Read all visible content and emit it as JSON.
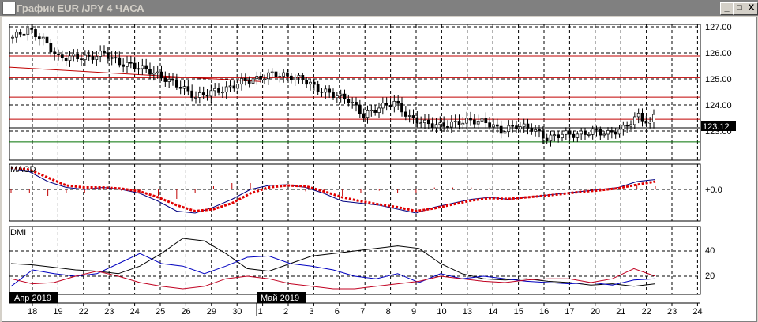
{
  "window": {
    "title": "График EUR /JPY  4 ЧАСА",
    "minimize": "_",
    "maximize": "□",
    "close": "X"
  },
  "price_axis": {
    "ticks": [
      "127.00",
      "126.00",
      "125.00",
      "124.00",
      "123.00"
    ],
    "tick_values": [
      127,
      126,
      125,
      124,
      123
    ],
    "current": "123.12",
    "current_value": 123.12
  },
  "levels": {
    "red": [
      125.88,
      125.05,
      124.3,
      123.45
    ],
    "green": 122.58,
    "trend_start": 125.45,
    "trend_end": 124.9
  },
  "candles_daily": [
    126.6,
    126.9,
    126.5,
    125.8,
    125.85,
    125.8,
    126.0,
    125.6,
    125.5,
    125.3,
    125.0,
    124.7,
    124.3,
    124.5,
    124.6,
    124.9,
    125.0,
    125.2,
    125.1,
    125.0,
    124.6,
    124.4,
    124.2,
    123.6,
    123.9,
    124.1,
    123.5,
    123.3,
    123.2,
    123.3,
    123.4,
    123.35,
    123.0,
    123.2,
    123.1,
    122.7,
    122.9,
    122.85,
    123.0,
    122.9,
    123.1,
    123.6,
    123.12
  ],
  "macd": {
    "label": "MACD",
    "zero_label": "+0.0",
    "line": [
      0.5,
      0.45,
      0.2,
      0.05,
      0,
      0.05,
      0.0,
      -0.1,
      -0.3,
      -0.55,
      -0.6,
      -0.45,
      -0.25,
      0,
      0.1,
      0.12,
      0.05,
      -0.1,
      -0.3,
      -0.35,
      -0.4,
      -0.5,
      -0.6,
      -0.45,
      -0.35,
      -0.25,
      -0.2,
      -0.25,
      -0.2,
      -0.15,
      -0.1,
      -0.05,
      0,
      0.05,
      0.2,
      0.25
    ],
    "signal": [
      0.55,
      0.5,
      0.3,
      0.1,
      0.05,
      0.05,
      0.02,
      -0.05,
      -0.2,
      -0.4,
      -0.55,
      -0.5,
      -0.35,
      -0.1,
      0.05,
      0.1,
      0.08,
      -0.05,
      -0.2,
      -0.3,
      -0.38,
      -0.45,
      -0.55,
      -0.48,
      -0.38,
      -0.28,
      -0.22,
      -0.24,
      -0.2,
      -0.16,
      -0.11,
      -0.06,
      -0.02,
      0.03,
      0.12,
      0.2
    ]
  },
  "dmi": {
    "label": "DMI",
    "ticks": [
      "40",
      "20"
    ],
    "tick_values": [
      40,
      20
    ],
    "adx": [
      30,
      29,
      27,
      25,
      24,
      22,
      28,
      38,
      50,
      48,
      38,
      26,
      24,
      30,
      36,
      38,
      40,
      42,
      44,
      42,
      30,
      22,
      18,
      17,
      18,
      16,
      15,
      13,
      14,
      12,
      14
    ],
    "plus_di": [
      12,
      25,
      22,
      20,
      22,
      30,
      38,
      30,
      28,
      22,
      28,
      35,
      36,
      30,
      28,
      25,
      20,
      18,
      22,
      15,
      22,
      18,
      20,
      18,
      16,
      15,
      14,
      15,
      13,
      17,
      18
    ],
    "minus_di": [
      18,
      14,
      15,
      20,
      24,
      20,
      15,
      12,
      10,
      12,
      18,
      20,
      18,
      14,
      12,
      10,
      10,
      12,
      14,
      16,
      20,
      18,
      16,
      15,
      17,
      18,
      18,
      15,
      18,
      26,
      20
    ]
  },
  "time_axis": {
    "month_labels": [
      "Апр 2019",
      "Май 2019"
    ],
    "dates": [
      "18",
      "19",
      "22",
      "23",
      "24",
      "25",
      "26",
      "29",
      "30",
      "1",
      "2",
      "3",
      "6",
      "7",
      "8",
      "9",
      "10",
      "13",
      "14",
      "15",
      "16",
      "17",
      "20",
      "21",
      "22",
      "23",
      "24"
    ]
  }
}
